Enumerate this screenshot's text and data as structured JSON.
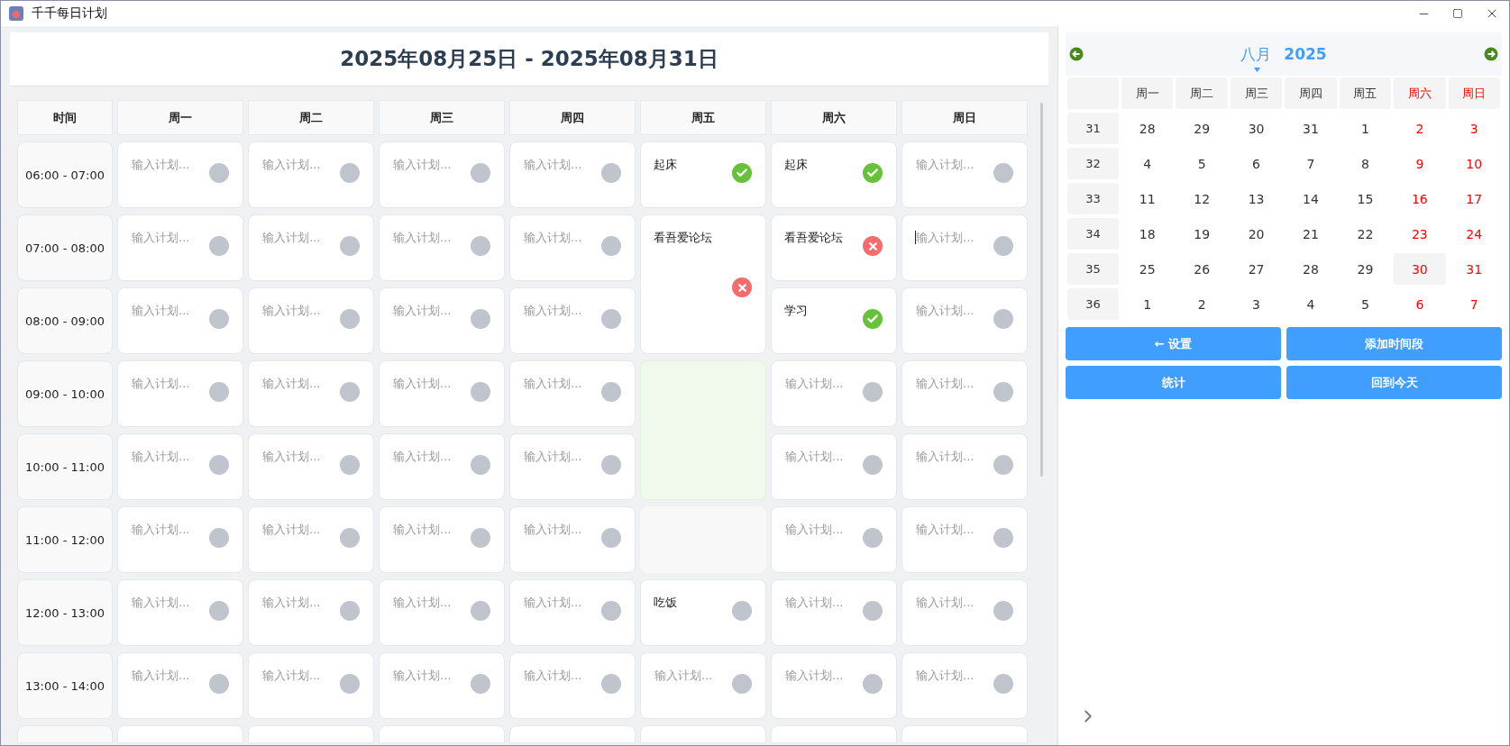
{
  "window": {
    "title": "千千每日计划"
  },
  "week_title": "2025年08月25日 - 2025年08月31日",
  "schedule": {
    "time_heading": "时间",
    "times": [
      "06:00 - 07:00",
      "07:00 - 08:00",
      "08:00 - 09:00",
      "09:00 - 10:00",
      "10:00 - 11:00",
      "11:00 - 12:00",
      "12:00 - 13:00",
      "13:00 - 14:00"
    ],
    "days": [
      {
        "label": "周一",
        "cells": [
          {
            "kind": "input",
            "placeholder": "输入计划...",
            "focused": false
          },
          {
            "kind": "input",
            "placeholder": "输入计划...",
            "focused": false
          },
          {
            "kind": "input",
            "placeholder": "输入计划...",
            "focused": false
          },
          {
            "kind": "input",
            "placeholder": "输入计划...",
            "focused": false
          },
          {
            "kind": "input",
            "placeholder": "输入计划...",
            "focused": false
          },
          {
            "kind": "input",
            "placeholder": "输入计划...",
            "focused": false
          },
          {
            "kind": "input",
            "placeholder": "输入计划...",
            "focused": false
          },
          {
            "kind": "input",
            "placeholder": "输入计划...",
            "focused": false
          }
        ]
      },
      {
        "label": "周二",
        "cells": [
          {
            "kind": "input",
            "placeholder": "输入计划...",
            "focused": false
          },
          {
            "kind": "input",
            "placeholder": "输入计划...",
            "focused": false
          },
          {
            "kind": "input",
            "placeholder": "输入计划...",
            "focused": false
          },
          {
            "kind": "input",
            "placeholder": "输入计划...",
            "focused": false
          },
          {
            "kind": "input",
            "placeholder": "输入计划...",
            "focused": false
          },
          {
            "kind": "input",
            "placeholder": "输入计划...",
            "focused": false
          },
          {
            "kind": "input",
            "placeholder": "输入计划...",
            "focused": false
          },
          {
            "kind": "input",
            "placeholder": "输入计划...",
            "focused": false
          }
        ]
      },
      {
        "label": "周三",
        "cells": [
          {
            "kind": "input",
            "placeholder": "输入计划...",
            "focused": false
          },
          {
            "kind": "input",
            "placeholder": "输入计划...",
            "focused": false
          },
          {
            "kind": "input",
            "placeholder": "输入计划...",
            "focused": false
          },
          {
            "kind": "input",
            "placeholder": "输入计划...",
            "focused": false
          },
          {
            "kind": "input",
            "placeholder": "输入计划...",
            "focused": false
          },
          {
            "kind": "input",
            "placeholder": "输入计划...",
            "focused": false
          },
          {
            "kind": "input",
            "placeholder": "输入计划...",
            "focused": false
          },
          {
            "kind": "input",
            "placeholder": "输入计划...",
            "focused": false
          }
        ]
      },
      {
        "label": "周四",
        "cells": [
          {
            "kind": "input",
            "placeholder": "输入计划...",
            "focused": false
          },
          {
            "kind": "input",
            "placeholder": "输入计划...",
            "focused": false
          },
          {
            "kind": "input",
            "placeholder": "输入计划...",
            "focused": false
          },
          {
            "kind": "input",
            "placeholder": "输入计划...",
            "focused": false
          },
          {
            "kind": "input",
            "placeholder": "输入计划...",
            "focused": false
          },
          {
            "kind": "input",
            "placeholder": "输入计划...",
            "focused": false
          },
          {
            "kind": "input",
            "placeholder": "输入计划...",
            "focused": false
          },
          {
            "kind": "input",
            "placeholder": "输入计划...",
            "focused": false
          }
        ]
      },
      {
        "label": "周五",
        "cells": [
          {
            "kind": "done",
            "text": "起床",
            "tall": false
          },
          {
            "kind": "failed",
            "text": "看吾爱论坛",
            "tall": true
          },
          {
            "kind": "block",
            "tall": true
          },
          {
            "kind": "blank"
          },
          {
            "kind": "pending",
            "text": "吃饭",
            "tall": false
          },
          {
            "kind": "input",
            "placeholder": "输入计划...",
            "focused": false
          }
        ]
      },
      {
        "label": "周六",
        "cells": [
          {
            "kind": "done",
            "text": "起床",
            "tall": false
          },
          {
            "kind": "failed",
            "text": "看吾爱论坛",
            "tall": false
          },
          {
            "kind": "done",
            "text": "学习",
            "tall": false
          },
          {
            "kind": "input",
            "placeholder": "输入计划...",
            "focused": false
          },
          {
            "kind": "input",
            "placeholder": "输入计划...",
            "focused": false
          },
          {
            "kind": "input",
            "placeholder": "输入计划...",
            "focused": false
          },
          {
            "kind": "input",
            "placeholder": "输入计划...",
            "focused": false
          },
          {
            "kind": "input",
            "placeholder": "输入计划...",
            "focused": false
          }
        ]
      },
      {
        "label": "周日",
        "cells": [
          {
            "kind": "input",
            "placeholder": "输入计划...",
            "focused": false
          },
          {
            "kind": "input",
            "placeholder": "输入计划...",
            "focused": true
          },
          {
            "kind": "input",
            "placeholder": "输入计划...",
            "focused": false
          },
          {
            "kind": "input",
            "placeholder": "输入计划...",
            "focused": false
          },
          {
            "kind": "input",
            "placeholder": "输入计划...",
            "focused": false
          },
          {
            "kind": "input",
            "placeholder": "输入计划...",
            "focused": false
          },
          {
            "kind": "input",
            "placeholder": "输入计划...",
            "focused": false
          },
          {
            "kind": "input",
            "placeholder": "输入计划...",
            "focused": false
          }
        ]
      }
    ]
  },
  "calendar": {
    "month": "八月",
    "year": "2025",
    "weekdays": [
      {
        "label": "周一",
        "weekend": false
      },
      {
        "label": "周二",
        "weekend": false
      },
      {
        "label": "周三",
        "weekend": false
      },
      {
        "label": "周四",
        "weekend": false
      },
      {
        "label": "周五",
        "weekend": false
      },
      {
        "label": "周六",
        "weekend": true
      },
      {
        "label": "周日",
        "weekend": true
      }
    ],
    "weeks": [
      {
        "week": "31",
        "days": [
          {
            "label": "28",
            "selected": false
          },
          {
            "label": "29",
            "selected": false
          },
          {
            "label": "30",
            "selected": false
          },
          {
            "label": "31",
            "selected": false
          },
          {
            "label": "1",
            "selected": false
          },
          {
            "label": "2",
            "selected": false
          },
          {
            "label": "3",
            "selected": false
          }
        ]
      },
      {
        "week": "32",
        "days": [
          {
            "label": "4",
            "selected": false
          },
          {
            "label": "5",
            "selected": false
          },
          {
            "label": "6",
            "selected": false
          },
          {
            "label": "7",
            "selected": false
          },
          {
            "label": "8",
            "selected": false
          },
          {
            "label": "9",
            "selected": false
          },
          {
            "label": "10",
            "selected": false
          }
        ]
      },
      {
        "week": "33",
        "days": [
          {
            "label": "11",
            "selected": false
          },
          {
            "label": "12",
            "selected": false
          },
          {
            "label": "13",
            "selected": false
          },
          {
            "label": "14",
            "selected": false
          },
          {
            "label": "15",
            "selected": false
          },
          {
            "label": "16",
            "selected": false
          },
          {
            "label": "17",
            "selected": false
          }
        ]
      },
      {
        "week": "34",
        "days": [
          {
            "label": "18",
            "selected": false
          },
          {
            "label": "19",
            "selected": false
          },
          {
            "label": "20",
            "selected": false
          },
          {
            "label": "21",
            "selected": false
          },
          {
            "label": "22",
            "selected": false
          },
          {
            "label": "23",
            "selected": false
          },
          {
            "label": "24",
            "selected": false
          }
        ]
      },
      {
        "week": "35",
        "days": [
          {
            "label": "25",
            "selected": false
          },
          {
            "label": "26",
            "selected": false
          },
          {
            "label": "27",
            "selected": false
          },
          {
            "label": "28",
            "selected": false
          },
          {
            "label": "29",
            "selected": false
          },
          {
            "label": "30",
            "selected": true
          },
          {
            "label": "31",
            "selected": false
          }
        ]
      },
      {
        "week": "36",
        "days": [
          {
            "label": "1",
            "selected": false
          },
          {
            "label": "2",
            "selected": false
          },
          {
            "label": "3",
            "selected": false
          },
          {
            "label": "4",
            "selected": false
          },
          {
            "label": "5",
            "selected": false
          },
          {
            "label": "6",
            "selected": false
          },
          {
            "label": "7",
            "selected": false
          }
        ]
      }
    ]
  },
  "buttons": [
    "← 设置",
    "添加时间段",
    "统计",
    "回到今天"
  ]
}
